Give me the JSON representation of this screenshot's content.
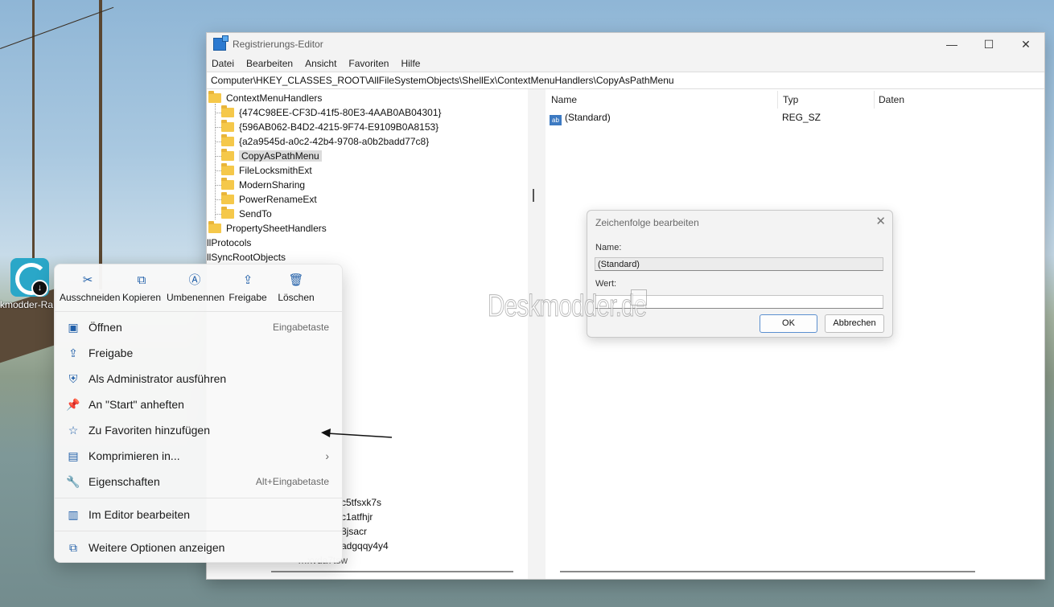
{
  "desktop": {
    "icon_label": "kmodder-Ra",
    "icon_name": "app-download-icon"
  },
  "window": {
    "title": "Registrierungs-Editor",
    "menu": [
      "Datei",
      "Bearbeiten",
      "Ansicht",
      "Favoriten",
      "Hilfe"
    ],
    "address": "Computer\\HKEY_CLASSES_ROOT\\AllFileSystemObjects\\ShellEx\\ContextMenuHandlers\\CopyAsPathMenu",
    "tree": {
      "parent": "ContextMenuHandlers",
      "children": [
        "{474C98EE-CF3D-41f5-80E3-4AAB0AB04301}",
        "{596AB062-B4D2-4215-9F74-E9109B0A8153}",
        "{a2a9545d-a0c2-42b4-9708-a0b2badd77c8}",
        "CopyAsPathMenu",
        "FileLocksmithExt",
        "ModernSharing",
        "PowerRenameExt",
        "SendTo"
      ],
      "selected": "CopyAsPathMenu",
      "sibling": "PropertySheetHandlers",
      "partial_1": "llProtocols",
      "partial_2": "llSyncRootObjects",
      "partial_bottom": [
        "c5tfsxk7s",
        "c1atfhjr",
        "8jsacr",
        "adgqqy4y4",
        "…xvda7tsw"
      ]
    },
    "columns": {
      "name": "Name",
      "type": "Typ",
      "data": "Daten"
    },
    "values": [
      {
        "name": "(Standard)",
        "type": "REG_SZ",
        "data": ""
      }
    ]
  },
  "dialog": {
    "title": "Zeichenfolge bearbeiten",
    "name_label": "Name:",
    "name_value": "(Standard)",
    "value_label": "Wert:",
    "value_value": "",
    "ok": "OK",
    "cancel": "Abbrechen"
  },
  "watermark": "Deskmodder.de",
  "context_menu": {
    "quick_actions": [
      {
        "label": "Ausschneiden",
        "icon": "scissors-icon",
        "glyph": "✂"
      },
      {
        "label": "Kopieren",
        "icon": "copy-icon",
        "glyph": "⧉"
      },
      {
        "label": "Umbenennen",
        "icon": "rename-icon",
        "glyph": "Ⓐ"
      },
      {
        "label": "Freigabe",
        "icon": "share-icon",
        "glyph": "⇪"
      },
      {
        "label": "Löschen",
        "icon": "trash-icon",
        "glyph": "🗑"
      }
    ],
    "items": [
      {
        "label": "Öffnen",
        "shortcut": "Eingabetaste",
        "icon": "open-icon",
        "glyph": "▣"
      },
      {
        "label": "Freigabe",
        "shortcut": "",
        "icon": "share-icon",
        "glyph": "⇪"
      },
      {
        "label": "Als Administrator ausführen",
        "shortcut": "",
        "icon": "shield-icon",
        "glyph": "⛨"
      },
      {
        "label": "An \"Start\" anheften",
        "shortcut": "",
        "icon": "pin-icon",
        "glyph": "📌"
      },
      {
        "label": "Zu Favoriten hinzufügen",
        "shortcut": "",
        "icon": "star-icon",
        "glyph": "☆"
      },
      {
        "label": "Komprimieren in...",
        "shortcut": "",
        "icon": "zip-icon",
        "glyph": "▤",
        "submenu": true
      },
      {
        "label": "Eigenschaften",
        "shortcut": "Alt+Eingabetaste",
        "icon": "wrench-icon",
        "glyph": "🔧"
      }
    ],
    "editor_item": {
      "label": "Im Editor bearbeiten",
      "icon": "notepad-icon",
      "glyph": "▥"
    },
    "more_item": {
      "label": "Weitere Optionen anzeigen",
      "icon": "more-options-icon",
      "glyph": "⧉"
    },
    "submenu_arrow": "›"
  }
}
